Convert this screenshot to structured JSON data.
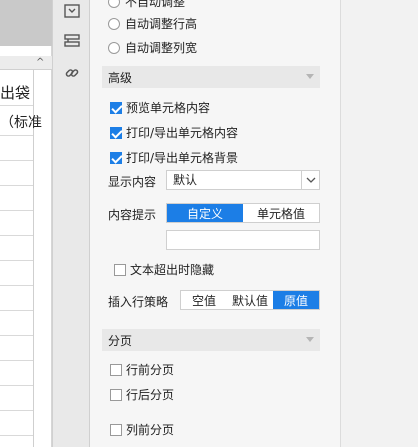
{
  "sheet": {
    "header_cell": "出袋",
    "sub_cell": "（标准"
  },
  "toolbar_icons": [
    "panel-collapse-icon",
    "layers-icon",
    "link-icon"
  ],
  "panel": {
    "resize_options": [
      {
        "label": "不自动调整"
      },
      {
        "label": "自动调整行高"
      },
      {
        "label": "自动调整列宽"
      }
    ],
    "advanced": {
      "title": "高级",
      "checkboxes": [
        {
          "label": "预览单元格内容",
          "checked": true
        },
        {
          "label": "打印/导出单元格内容",
          "checked": true
        },
        {
          "label": "打印/导出单元格背景",
          "checked": true
        }
      ],
      "display_content": {
        "label": "显示内容",
        "value": "默认"
      },
      "content_hint": {
        "label": "内容提示",
        "options": [
          "自定义",
          "单元格值"
        ],
        "selected": "自定义"
      },
      "hide_overflow": {
        "label": "文本超出时隐藏",
        "checked": false
      },
      "insert_policy": {
        "label": "插入行策略",
        "options": [
          "空值",
          "默认值",
          "原值"
        ],
        "selected": "原值"
      }
    },
    "paging": {
      "title": "分页",
      "checkboxes": [
        {
          "label": "行前分页",
          "checked": false
        },
        {
          "label": "行后分页",
          "checked": false
        },
        {
          "label": "列前分页",
          "checked": false
        }
      ]
    }
  },
  "colors": {
    "accent": "#1c7ee6"
  }
}
